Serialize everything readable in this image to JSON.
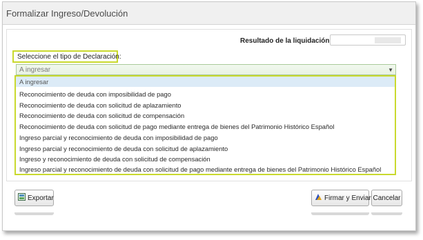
{
  "window": {
    "title": "Formalizar Ingreso/Devolución"
  },
  "result": {
    "label": "Resultado de la liquidación",
    "value": ""
  },
  "declaration": {
    "label": "Seleccione el tipo de Declaración:",
    "selected": "A ingresar",
    "options": [
      "A ingresar",
      "Reconocimiento de deuda con imposibilidad de pago",
      "Reconocimiento de deuda con solicitud de aplazamiento",
      "Reconocimiento de deuda con solicitud de compensación",
      "Reconocimiento de deuda con solicitud de pago mediante entrega de bienes del Patrimonio Histórico Español",
      "Ingreso parcial y reconocimiento de deuda con imposibilidad de pago",
      "Ingreso parcial y reconocimiento de deuda con solicitud de aplazamiento",
      "Ingreso y reconocimiento de deuda con solicitud de compensación",
      "Ingreso parcial y reconocimiento de deuda con solicitud de pago mediante entrega de bienes del Patrimonio Histórico Español"
    ]
  },
  "buttons": {
    "export_label": "Exportar",
    "sign_label": "Firmar y Enviar",
    "cancel_label": "Cancelar"
  },
  "icons": {
    "export": "export-icon",
    "sign": "sign-icon",
    "dropdown": "chevron-down-icon"
  },
  "colors": {
    "highlight": "#c9d92d",
    "selected_option": "#dcebf7"
  }
}
